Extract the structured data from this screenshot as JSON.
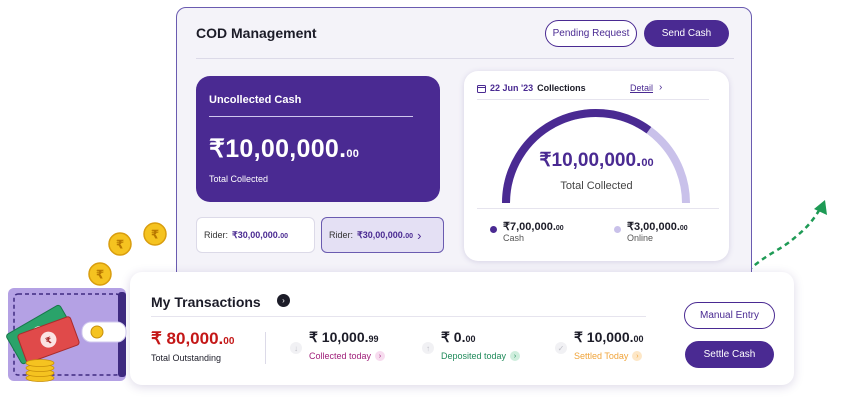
{
  "cod": {
    "title": "COD Management",
    "pending_request": "Pending Request",
    "send_cash": "Send Cash",
    "uncollected": {
      "title": "Uncollected Cash",
      "amount": "₹10,00,000.",
      "amount_decimal": "00",
      "label": "Total Collected"
    },
    "riders": [
      {
        "prefix": "Rider:",
        "amount": "₹30,00,000.",
        "decimal": "00"
      },
      {
        "prefix": "Rider:",
        "amount": "₹30,00,000.",
        "decimal": "00",
        "chevron": "›"
      }
    ],
    "collections": {
      "date": "22 Jun '23",
      "title": "Collections",
      "detail": "Detail",
      "detail_chevron": "›",
      "amount": "₹10,00,000.",
      "amount_decimal": "00",
      "label": "Total Collected",
      "gauge_fraction": 0.7,
      "legend": [
        {
          "amount": "₹7,00,000.",
          "decimal": "00",
          "label": "Cash",
          "color": "#4a2a92"
        },
        {
          "amount": "₹3,00,000.",
          "decimal": "00",
          "label": "Online",
          "color": "#c9c1ea"
        }
      ]
    }
  },
  "transactions": {
    "title": "My Transactions",
    "outstanding": {
      "amount": "₹ 80,000.",
      "decimal": "00",
      "label": "Total Outstanding"
    },
    "stats": [
      {
        "amount": "₹ 10,000.",
        "decimal": "99",
        "label": "Collected today",
        "color": "#a0207a",
        "chip_bg": "#f7dcef"
      },
      {
        "amount": "₹ 0.",
        "decimal": "00",
        "label": "Deposited today",
        "color": "#1f8a5a",
        "chip_bg": "#cfeedd"
      },
      {
        "amount": "₹ 10,000.",
        "decimal": "00",
        "label": "Settled Today",
        "color": "#f0a43a",
        "chip_bg": "#fde7c7"
      }
    ],
    "manual_entry": "Manual Entry",
    "settle_cash": "Settle Cash"
  },
  "colors": {
    "brand": "#4a2a92",
    "brand_light": "#c9c1ea",
    "arrow_green": "#1e9a55",
    "coin": "#f5c320"
  },
  "icons": {
    "calendar": "calendar-icon",
    "coin": "rupee-coin-icon",
    "wallet": "wallet-icon",
    "arrow": "arrow-right-icon"
  }
}
